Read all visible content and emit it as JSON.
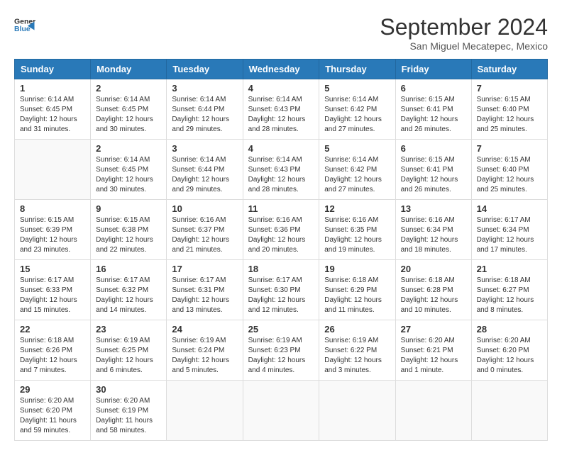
{
  "header": {
    "logo": {
      "general": "General",
      "blue": "Blue"
    },
    "title": "September 2024",
    "location": "San Miguel Mecatepec, Mexico"
  },
  "calendar": {
    "days_of_week": [
      "Sunday",
      "Monday",
      "Tuesday",
      "Wednesday",
      "Thursday",
      "Friday",
      "Saturday"
    ],
    "weeks": [
      [
        {
          "day": "",
          "info": ""
        },
        {
          "day": "2",
          "info": "Sunrise: 6:14 AM\nSunset: 6:45 PM\nDaylight: 12 hours\nand 30 minutes."
        },
        {
          "day": "3",
          "info": "Sunrise: 6:14 AM\nSunset: 6:44 PM\nDaylight: 12 hours\nand 29 minutes."
        },
        {
          "day": "4",
          "info": "Sunrise: 6:14 AM\nSunset: 6:43 PM\nDaylight: 12 hours\nand 28 minutes."
        },
        {
          "day": "5",
          "info": "Sunrise: 6:14 AM\nSunset: 6:42 PM\nDaylight: 12 hours\nand 27 minutes."
        },
        {
          "day": "6",
          "info": "Sunrise: 6:15 AM\nSunset: 6:41 PM\nDaylight: 12 hours\nand 26 minutes."
        },
        {
          "day": "7",
          "info": "Sunrise: 6:15 AM\nSunset: 6:40 PM\nDaylight: 12 hours\nand 25 minutes."
        }
      ],
      [
        {
          "day": "8",
          "info": "Sunrise: 6:15 AM\nSunset: 6:39 PM\nDaylight: 12 hours\nand 23 minutes."
        },
        {
          "day": "9",
          "info": "Sunrise: 6:15 AM\nSunset: 6:38 PM\nDaylight: 12 hours\nand 22 minutes."
        },
        {
          "day": "10",
          "info": "Sunrise: 6:16 AM\nSunset: 6:37 PM\nDaylight: 12 hours\nand 21 minutes."
        },
        {
          "day": "11",
          "info": "Sunrise: 6:16 AM\nSunset: 6:36 PM\nDaylight: 12 hours\nand 20 minutes."
        },
        {
          "day": "12",
          "info": "Sunrise: 6:16 AM\nSunset: 6:35 PM\nDaylight: 12 hours\nand 19 minutes."
        },
        {
          "day": "13",
          "info": "Sunrise: 6:16 AM\nSunset: 6:34 PM\nDaylight: 12 hours\nand 18 minutes."
        },
        {
          "day": "14",
          "info": "Sunrise: 6:17 AM\nSunset: 6:34 PM\nDaylight: 12 hours\nand 17 minutes."
        }
      ],
      [
        {
          "day": "15",
          "info": "Sunrise: 6:17 AM\nSunset: 6:33 PM\nDaylight: 12 hours\nand 15 minutes."
        },
        {
          "day": "16",
          "info": "Sunrise: 6:17 AM\nSunset: 6:32 PM\nDaylight: 12 hours\nand 14 minutes."
        },
        {
          "day": "17",
          "info": "Sunrise: 6:17 AM\nSunset: 6:31 PM\nDaylight: 12 hours\nand 13 minutes."
        },
        {
          "day": "18",
          "info": "Sunrise: 6:17 AM\nSunset: 6:30 PM\nDaylight: 12 hours\nand 12 minutes."
        },
        {
          "day": "19",
          "info": "Sunrise: 6:18 AM\nSunset: 6:29 PM\nDaylight: 12 hours\nand 11 minutes."
        },
        {
          "day": "20",
          "info": "Sunrise: 6:18 AM\nSunset: 6:28 PM\nDaylight: 12 hours\nand 10 minutes."
        },
        {
          "day": "21",
          "info": "Sunrise: 6:18 AM\nSunset: 6:27 PM\nDaylight: 12 hours\nand 8 minutes."
        }
      ],
      [
        {
          "day": "22",
          "info": "Sunrise: 6:18 AM\nSunset: 6:26 PM\nDaylight: 12 hours\nand 7 minutes."
        },
        {
          "day": "23",
          "info": "Sunrise: 6:19 AM\nSunset: 6:25 PM\nDaylight: 12 hours\nand 6 minutes."
        },
        {
          "day": "24",
          "info": "Sunrise: 6:19 AM\nSunset: 6:24 PM\nDaylight: 12 hours\nand 5 minutes."
        },
        {
          "day": "25",
          "info": "Sunrise: 6:19 AM\nSunset: 6:23 PM\nDaylight: 12 hours\nand 4 minutes."
        },
        {
          "day": "26",
          "info": "Sunrise: 6:19 AM\nSunset: 6:22 PM\nDaylight: 12 hours\nand 3 minutes."
        },
        {
          "day": "27",
          "info": "Sunrise: 6:20 AM\nSunset: 6:21 PM\nDaylight: 12 hours\nand 1 minute."
        },
        {
          "day": "28",
          "info": "Sunrise: 6:20 AM\nSunset: 6:20 PM\nDaylight: 12 hours\nand 0 minutes."
        }
      ],
      [
        {
          "day": "29",
          "info": "Sunrise: 6:20 AM\nSunset: 6:20 PM\nDaylight: 11 hours\nand 59 minutes."
        },
        {
          "day": "30",
          "info": "Sunrise: 6:20 AM\nSunset: 6:19 PM\nDaylight: 11 hours\nand 58 minutes."
        },
        {
          "day": "",
          "info": ""
        },
        {
          "day": "",
          "info": ""
        },
        {
          "day": "",
          "info": ""
        },
        {
          "day": "",
          "info": ""
        },
        {
          "day": "",
          "info": ""
        }
      ]
    ],
    "first_week": [
      {
        "day": "1",
        "info": "Sunrise: 6:14 AM\nSunset: 6:45 PM\nDaylight: 12 hours\nand 31 minutes."
      },
      {
        "day": "2",
        "info": "Sunrise: 6:14 AM\nSunset: 6:45 PM\nDaylight: 12 hours\nand 30 minutes."
      },
      {
        "day": "3",
        "info": "Sunrise: 6:14 AM\nSunset: 6:44 PM\nDaylight: 12 hours\nand 29 minutes."
      },
      {
        "day": "4",
        "info": "Sunrise: 6:14 AM\nSunset: 6:43 PM\nDaylight: 12 hours\nand 28 minutes."
      },
      {
        "day": "5",
        "info": "Sunrise: 6:14 AM\nSunset: 6:42 PM\nDaylight: 12 hours\nand 27 minutes."
      },
      {
        "day": "6",
        "info": "Sunrise: 6:15 AM\nSunset: 6:41 PM\nDaylight: 12 hours\nand 26 minutes."
      },
      {
        "day": "7",
        "info": "Sunrise: 6:15 AM\nSunset: 6:40 PM\nDaylight: 12 hours\nand 25 minutes."
      }
    ]
  }
}
